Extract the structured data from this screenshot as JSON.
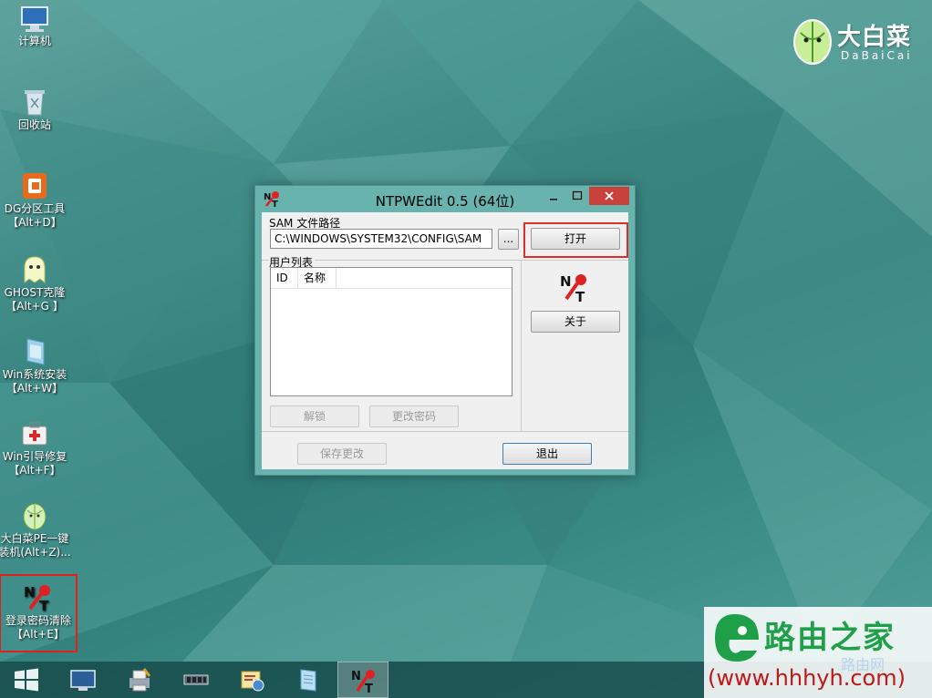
{
  "desktop": {
    "icons": [
      {
        "label": "计算机"
      },
      {
        "label": "回收站"
      },
      {
        "label": "DG分区工具\n【Alt+D】"
      },
      {
        "label": "GHOST克隆\n【Alt+G 】"
      },
      {
        "label": "Win系统安装\n【Alt+W】"
      },
      {
        "label": "Win引导修复\n【Alt+F】"
      },
      {
        "label": "大白菜PE一键\n装机(Alt+Z)..."
      },
      {
        "label": "登录密码清除\n【Alt+E】"
      }
    ],
    "brand_logo": {
      "name": "大白菜",
      "sub": "DaBaiCai"
    }
  },
  "window": {
    "title": "NTPWEdit 0.5 (64位)",
    "sam_group_label": "SAM 文件路径",
    "sam_path_value": "C:\\WINDOWS\\SYSTEM32\\CONFIG\\SAM",
    "browse_label": "...",
    "open_label": "打开",
    "user_list_label": "用户列表",
    "columns": [
      "ID",
      "名称"
    ],
    "unlock_label": "解锁",
    "change_password_label": "更改密码",
    "about_label": "关于",
    "save_label": "保存更改",
    "exit_label": "退出"
  },
  "watermark": {
    "brand": "路由之家",
    "url": "(www.hhhyh.com)",
    "faded": "路由网"
  },
  "colors": {
    "highlight": "#d9302c",
    "close_button": "#c8413b",
    "desktop_teal": "#3f8b86"
  }
}
